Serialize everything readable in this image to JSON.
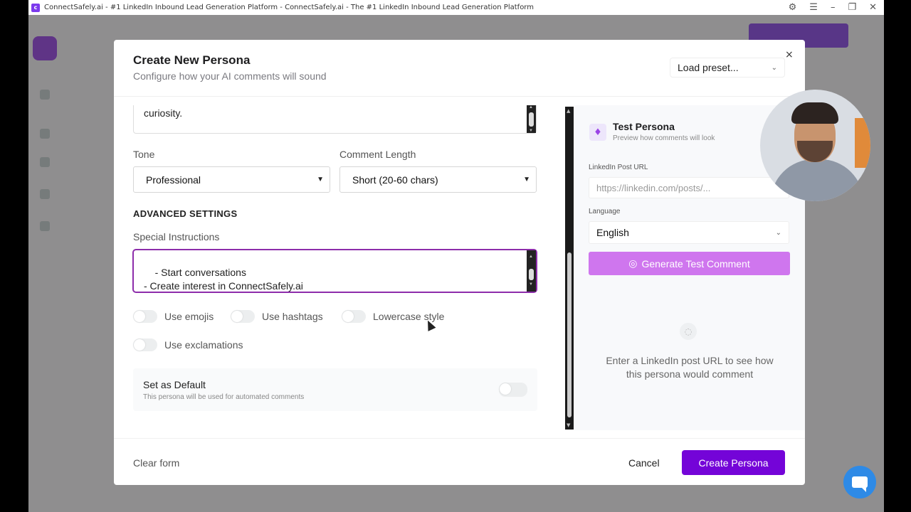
{
  "browser": {
    "title": "ConnectSafely.ai - #1 LinkedIn Inbound Lead Generation Platform - ConnectSafely.ai - The #1 LinkedIn Inbound Lead Generation Platform"
  },
  "modal": {
    "title": "Create New Persona",
    "subtitle": "Configure how your AI comments will sound",
    "preset_placeholder": "Load preset...",
    "close_label": "×"
  },
  "form": {
    "description_tail": "curiosity.",
    "tone": {
      "label": "Tone",
      "value": "Professional"
    },
    "comment_length": {
      "label": "Comment Length",
      "value": "Short (20-60 chars)"
    },
    "advanced_heading": "ADVANCED SETTINGS",
    "instructions": {
      "label": "Special Instructions",
      "value": "- Start conversations\n- Create interest in ConnectSafely.ai"
    },
    "toggles": [
      {
        "label": "Use emojis",
        "on": false
      },
      {
        "label": "Use hashtags",
        "on": false
      },
      {
        "label": "Lowercase style",
        "on": false
      },
      {
        "label": "Use exclamations",
        "on": false
      }
    ],
    "default": {
      "title": "Set as Default",
      "subtitle": "This persona will be used for automated comments",
      "on": false
    }
  },
  "test_panel": {
    "title": "Test Persona",
    "subtitle": "Preview how comments will look",
    "url_label": "LinkedIn Post URL",
    "url_placeholder": "https://linkedin.com/posts/...",
    "language_label": "Language",
    "language_value": "English",
    "generate_label": "Generate Test Comment",
    "empty_text": "Enter a LinkedIn post URL to see how this persona would comment"
  },
  "footer": {
    "clear_label": "Clear form",
    "cancel_label": "Cancel",
    "create_label": "Create Persona"
  },
  "colors": {
    "primary": "#7404d8",
    "generate_button": "#cf76ee",
    "instructions_border": "#8d2dab",
    "chat_fab": "#2e8ae6"
  },
  "icons": [
    "lightbulb-icon",
    "chat-bubble-icon",
    "close-icon",
    "chevron-down-icon",
    "sparkle-icon",
    "extensions-icon",
    "menu-icon",
    "minimize-icon",
    "maximize-icon"
  ]
}
